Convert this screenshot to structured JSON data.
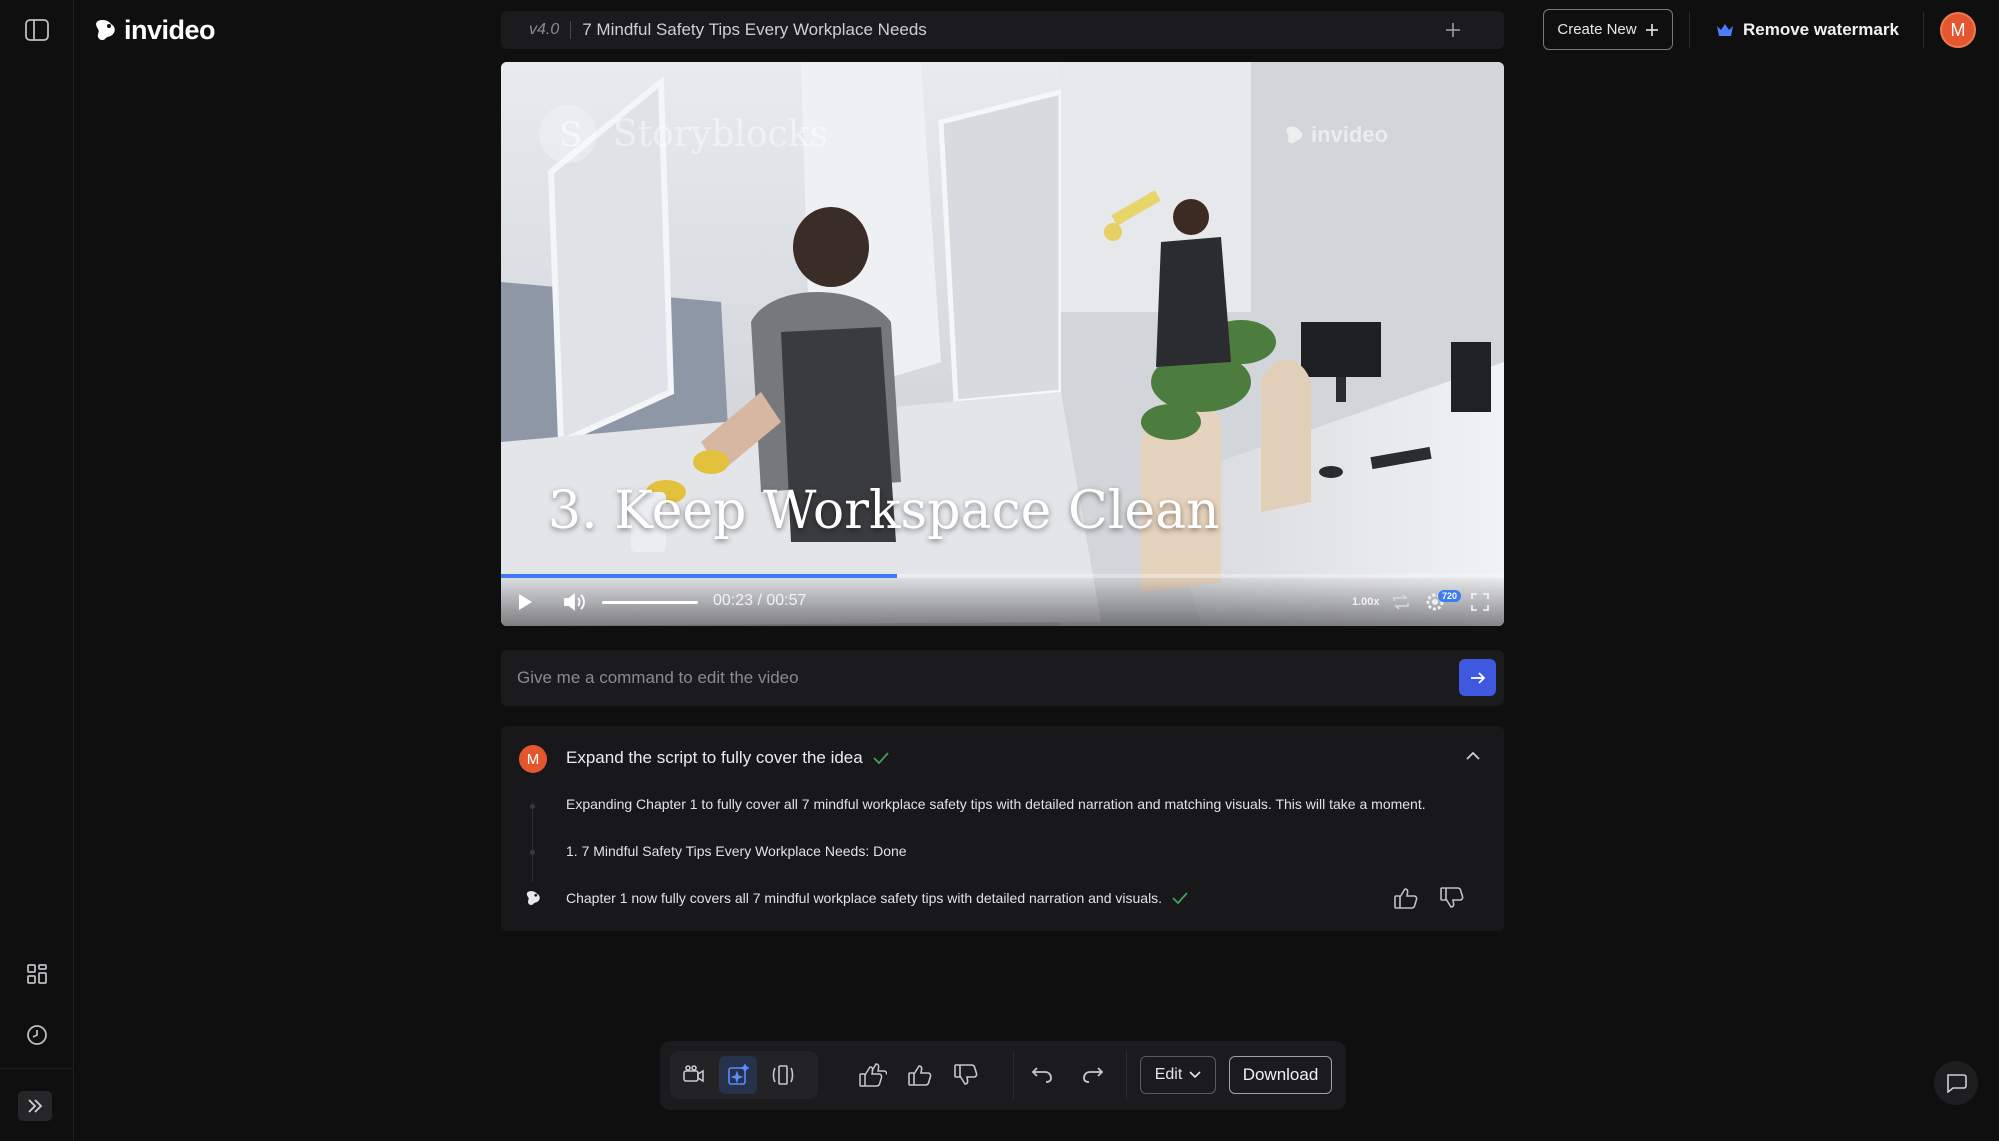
{
  "header": {
    "logo_text": "invideo",
    "version": "v4.0",
    "project_title": "7 Mindful Safety Tips Every Workplace Needs",
    "create_new_label": "Create New",
    "remove_watermark_label": "Remove watermark",
    "avatar_initial": "M"
  },
  "video": {
    "overlay_title": "3. Keep Workspace Clean",
    "watermark_storyblocks": "Storyblocks",
    "watermark_invideo": "invideo",
    "time": "00:23 / 00:57",
    "progress": 0.395,
    "volume": 1.0,
    "speed": "1.00x",
    "quality": "720"
  },
  "command": {
    "placeholder": "Give me a command to edit the video"
  },
  "chat": {
    "avatar_initial": "M",
    "request": "Expand the script to fully cover the idea",
    "messages": [
      "Expanding Chapter 1 to fully cover all 7 mindful workplace safety tips with detailed narration and matching visuals. This will take a moment.",
      "1. 7 Mindful Safety Tips Every Workplace Needs: Done",
      "Chapter 1 now fully covers all 7 mindful workplace safety tips with detailed narration and visuals."
    ]
  },
  "toolbar": {
    "edit_label": "Edit",
    "download_label": "Download"
  },
  "colors": {
    "accent": "#3f58e0",
    "progress": "#3d7bf2",
    "avatar": "#e4572e",
    "success": "#3fa05a"
  }
}
